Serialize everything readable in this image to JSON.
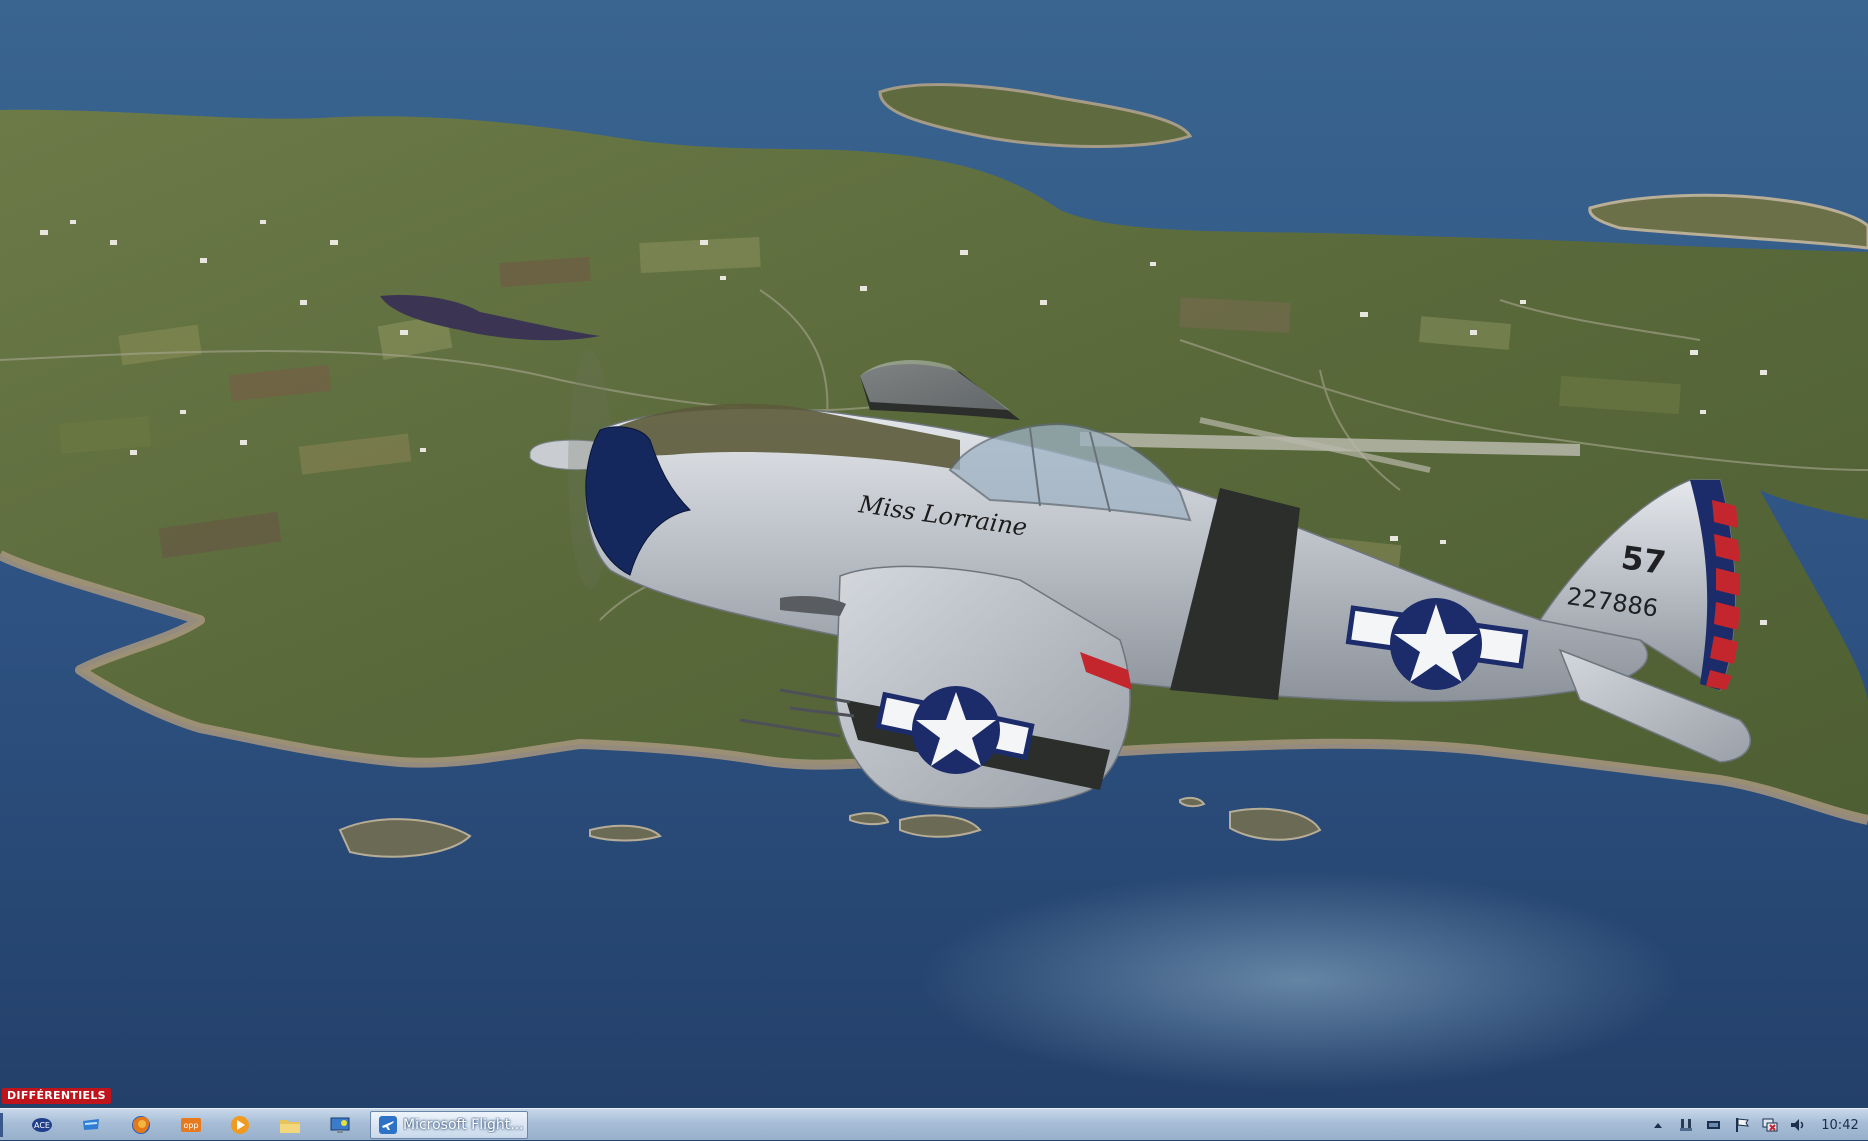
{
  "overlay": {
    "label": "DIFFÉRENTIELS"
  },
  "aircraft": {
    "nose_art": "Miss Lorraine",
    "code": "57",
    "serial": "227886"
  },
  "taskbar": {
    "pinned_icons": [
      "ace-app-icon",
      "network-app-icon",
      "firefox-icon",
      "opp-app-icon",
      "media-player-icon",
      "folder-icon",
      "control-panel-icon"
    ],
    "active_window": {
      "label": "Microsoft Flight...",
      "icon": "airplane-icon"
    },
    "tray_icons": [
      "show-hidden-icons-chevron-icon",
      "usb-devices-icon",
      "battery-icon",
      "action-center-flag-icon",
      "network-icon",
      "volume-icon"
    ],
    "clock": "10:42"
  },
  "colors": {
    "sea": "#2f5484",
    "land": "#5d6b3a",
    "aircraft_silver": "#c8ccd2",
    "invasion_stripe": "#2b2e2a",
    "star_blue": "#1c2c6a",
    "rudder_red": "#c4262e",
    "taskbar": "#a7bdd6"
  }
}
